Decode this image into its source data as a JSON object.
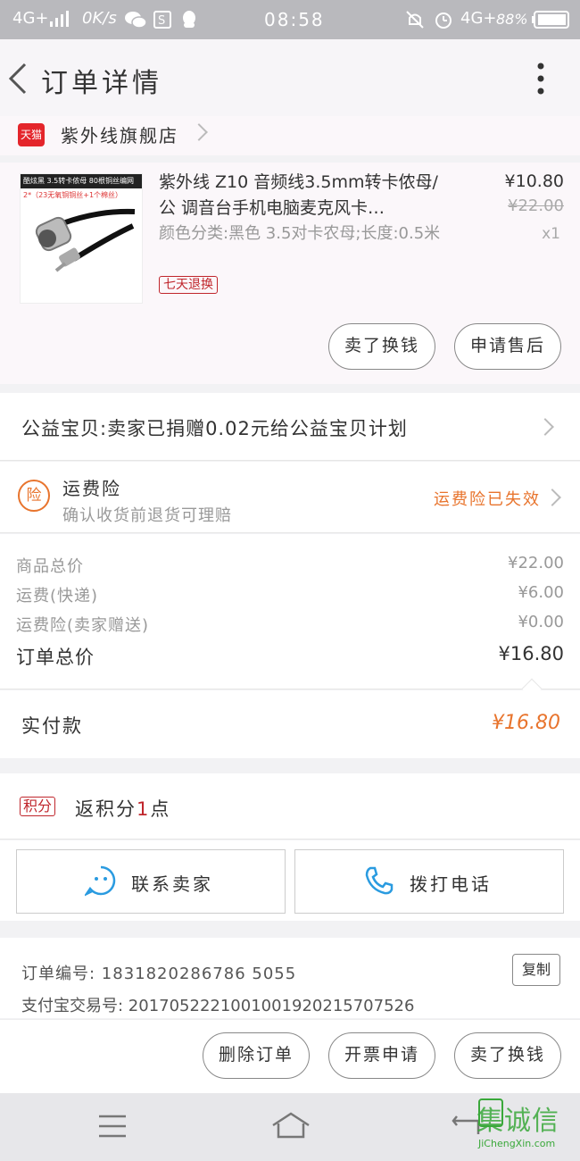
{
  "status_bar": {
    "network_left": "4G+",
    "speed": "0K/s",
    "time": "08:58",
    "network_right": "4G+",
    "battery": "88%"
  },
  "header": {
    "title": "订单详情"
  },
  "shop": {
    "badge": "天猫",
    "name": "紫外线旗舰店"
  },
  "product": {
    "thumb_banner": "酷炫黑  3.5转卡侬母  80根铜丝编网",
    "thumb_sub": "2*（23无氧铜铜丝+1个棉丝）",
    "title": "紫外线 Z10 音频线3.5mm转卡侬母/公 调音台手机电脑麦克风卡…",
    "variant": "颜色分类:黑色 3.5对卡农母;长度:0.5米",
    "tag": "七天退换",
    "price": "¥10.80",
    "original_price": "¥22.00",
    "quantity": "x1",
    "btn_change": "卖了换钱",
    "btn_aftersale": "申请售后"
  },
  "charity": {
    "text": "公益宝贝:卖家已捐赠0.02元给公益宝贝计划"
  },
  "insurance": {
    "icon_char": "险",
    "title": "运费险",
    "subtitle": "确认收货前退货可理赔",
    "status": "运费险已失效"
  },
  "fees": {
    "rows": [
      {
        "label": "商品总价",
        "value": "¥22.00"
      },
      {
        "label": "运费(快递)",
        "value": "¥6.00"
      },
      {
        "label": "运费险(卖家赠送)",
        "value": "¥0.00"
      }
    ],
    "total_label": "订单总价",
    "total_value": "¥16.80",
    "paid_label": "实付款",
    "paid_value": "¥16.80"
  },
  "points": {
    "badge": "积分",
    "prefix": "返积分",
    "count": "1",
    "suffix": "点"
  },
  "contact": {
    "seller": "联系卖家",
    "call": "拨打电话"
  },
  "order_info": {
    "order_no": "订单编号: 1831820286786 5055",
    "alipay_no": "支付宝交易号: 2017052221001001920215707526",
    "copy": "复制"
  },
  "bottom_actions": {
    "delete": "删除订单",
    "invoice": "开票申请",
    "resell": "卖了换钱"
  },
  "watermark": {
    "brand": "集诚信",
    "url": "JiChengXin.com"
  },
  "colors": {
    "accent_orange": "#e8742d",
    "tmall_red": "#e4252b",
    "link_blue": "#2a9be0"
  }
}
